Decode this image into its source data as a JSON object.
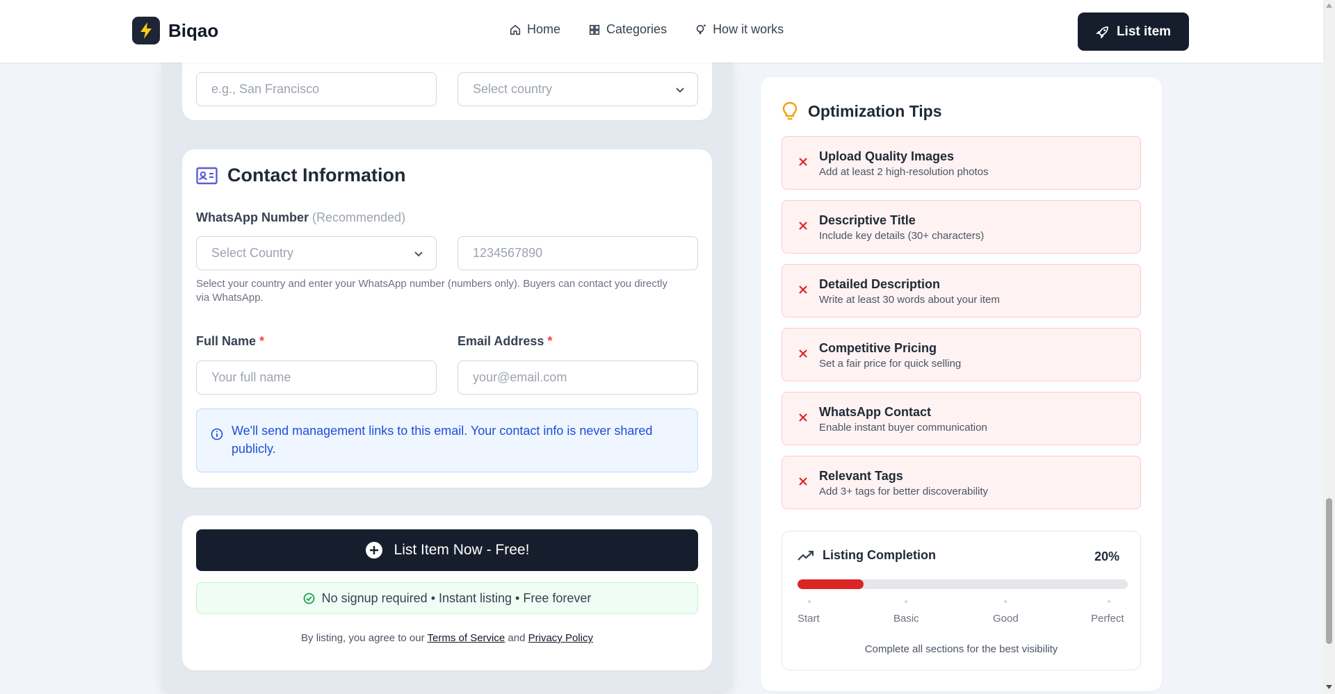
{
  "header": {
    "brand": "Biqao",
    "nav": [
      {
        "label": "Home",
        "icon": "home-icon"
      },
      {
        "label": "Categories",
        "icon": "grid-icon"
      },
      {
        "label": "How it works",
        "icon": "bulb-question-icon"
      }
    ],
    "cta_label": "List item"
  },
  "location": {
    "city_placeholder": "e.g., San Francisco",
    "country_placeholder": "Select country"
  },
  "contact": {
    "title": "Contact Information",
    "whatsapp_label": "WhatsApp Number",
    "whatsapp_hint": "(Recommended)",
    "country_select": "Select Country",
    "phone_placeholder": "1234567890",
    "help_text": "Select your country and enter your WhatsApp number (numbers only). Buyers can contact you directly via WhatsApp.",
    "full_name_label": "Full Name",
    "email_label": "Email Address",
    "required_mark": "*",
    "full_name_placeholder": "Your full name",
    "email_placeholder": "your@email.com",
    "info_text": "We'll send management links to this email. Your contact info is never shared publicly."
  },
  "submit": {
    "button_label": "List Item Now - Free!",
    "perks": "No signup required • Instant listing • Free forever",
    "terms_prefix": "By listing, you agree to our",
    "terms_link": "Terms of Service",
    "terms_and": "and",
    "privacy_link": "Privacy Policy"
  },
  "tips": {
    "title": "Optimization Tips",
    "items": [
      {
        "title": "Upload Quality Images",
        "desc": "Add at least 2 high-resolution photos"
      },
      {
        "title": "Descriptive Title",
        "desc": "Include key details (30+ characters)"
      },
      {
        "title": "Detailed Description",
        "desc": "Write at least 30 words about your item"
      },
      {
        "title": "Competitive Pricing",
        "desc": "Set a fair price for quick selling"
      },
      {
        "title": "WhatsApp Contact",
        "desc": "Enable instant buyer communication"
      },
      {
        "title": "Relevant Tags",
        "desc": "Add 3+ tags for better discoverability"
      }
    ],
    "completion": {
      "title": "Listing Completion",
      "percent_label": "20%",
      "progress_fraction": 0.2,
      "milestones": [
        "Start",
        "Basic",
        "Good",
        "Perfect"
      ],
      "note": "Complete all sections for the best visibility"
    }
  },
  "colors": {
    "primary": "#161d2c",
    "danger": "#dc2626",
    "info": "#1d4ed8",
    "success": "#16a34a",
    "accent": "#5b5bd6",
    "tip_bulb": "#f59e0b"
  }
}
